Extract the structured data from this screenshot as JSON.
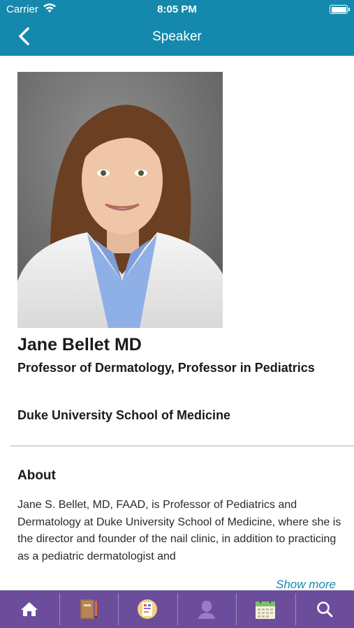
{
  "status_bar": {
    "carrier": "Carrier",
    "time": "8:05 PM"
  },
  "nav": {
    "title": "Speaker",
    "back_icon": "chevron-left-icon"
  },
  "speaker": {
    "name": "Jane Bellet MD",
    "title": "Professor of Dermatology, Professor in Pediatrics",
    "organization": "Duke University School of Medicine"
  },
  "about": {
    "heading": "About",
    "text": "Jane S. Bellet, MD, FAAD, is Professor of Pediatrics and Dermatology at Duke University School of Medicine, where she is the director and founder of the nail clinic, in addition to practicing as a pediatric dermatologist and",
    "show_more": "Show more"
  },
  "tabbar": {
    "background": "#6c4d9c",
    "items": [
      {
        "icon": "home-icon"
      },
      {
        "icon": "notebook-icon"
      },
      {
        "icon": "poster-icon"
      },
      {
        "icon": "speaker-person-icon"
      },
      {
        "icon": "calendar-icon"
      },
      {
        "icon": "search-icon"
      }
    ]
  },
  "colors": {
    "header": "#1589ad",
    "accent": "#1589ad"
  }
}
